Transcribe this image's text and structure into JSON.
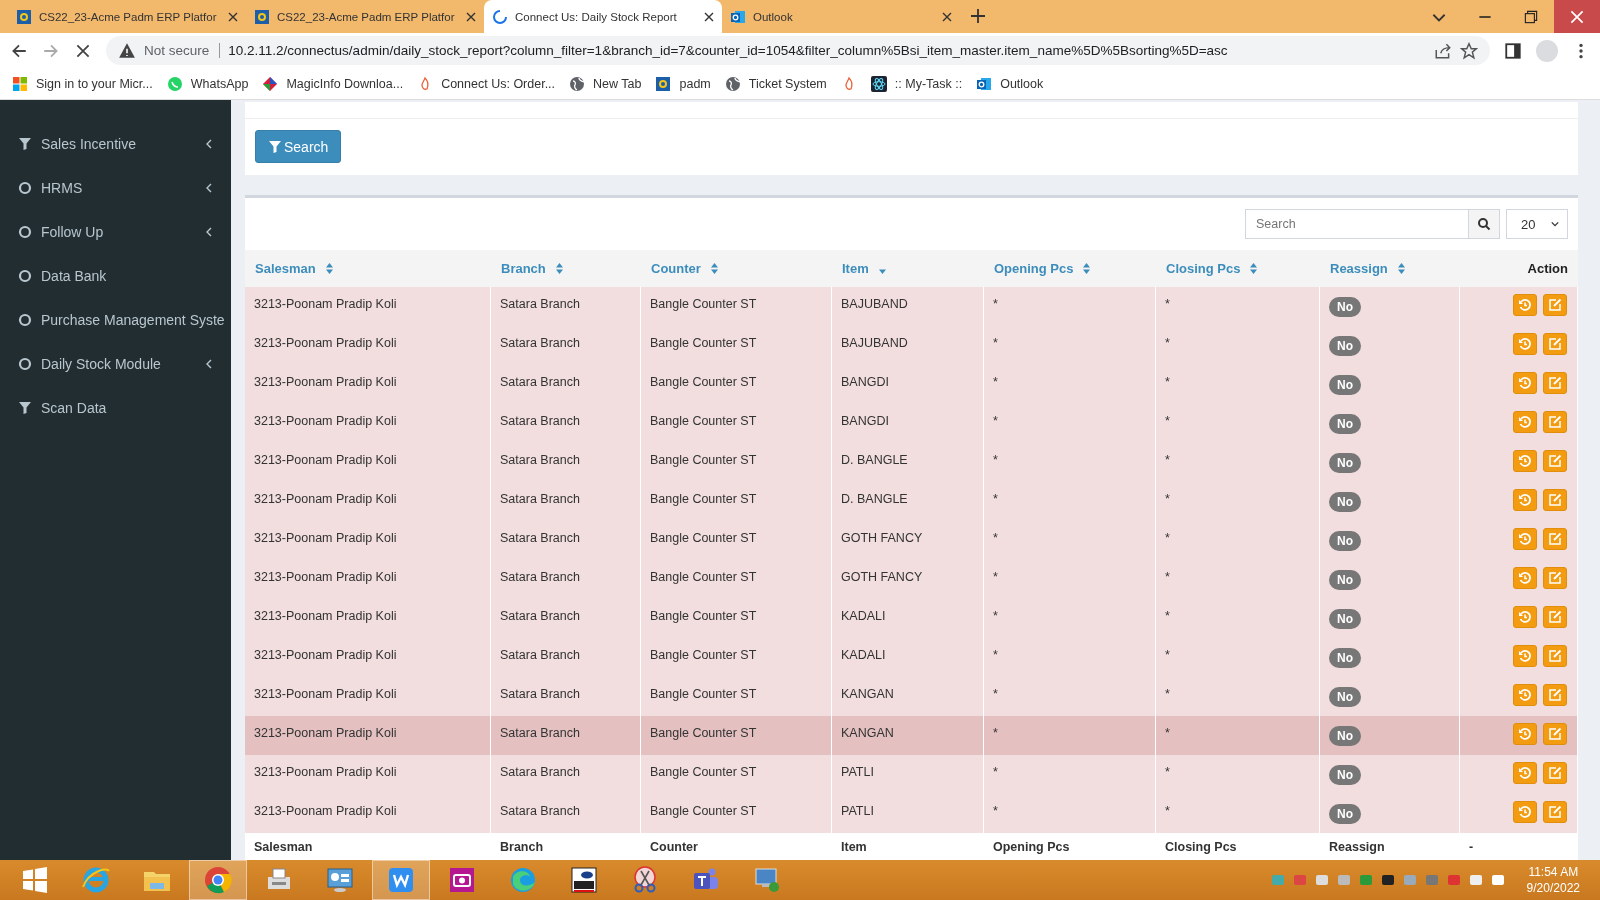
{
  "browser": {
    "tabs": [
      {
        "title": "CS22_23-Acme Padm ERP Platfor",
        "kind": "erp",
        "selected": false
      },
      {
        "title": "CS22_23-Acme Padm ERP Platfor",
        "kind": "erp",
        "selected": false
      },
      {
        "title": "Connect Us: Daily Stock Report",
        "kind": "loading",
        "selected": true
      },
      {
        "title": "Outlook",
        "kind": "outlook",
        "selected": false
      }
    ],
    "security": "Not secure",
    "url": "10.2.11.2/connectus/admin/daily_stock_report?column_filter=1&branch_id=7&counter_id=1054&filter_column%5Bsi_item_master.item_name%5D%5Bsorting%5D=asc",
    "bookmarks": [
      {
        "label": "Sign in to your Micr...",
        "kind": "windows"
      },
      {
        "label": "WhatsApp",
        "kind": "whatsapp"
      },
      {
        "label": "MagicInfo Downloa...",
        "kind": "diamond"
      },
      {
        "label": "Connect Us: Order...",
        "kind": "connect"
      },
      {
        "label": "New Tab",
        "kind": "globe"
      },
      {
        "label": "padm",
        "kind": "erp"
      },
      {
        "label": "Ticket System",
        "kind": "globe"
      },
      {
        "kind": "connect"
      },
      {
        "label": ":: My-Task ::",
        "kind": "atom"
      },
      {
        "label": "Outlook",
        "kind": "outlook"
      }
    ]
  },
  "sidebar": {
    "items": [
      {
        "label": "Sales Incentive",
        "kind": "filter",
        "expandable": true
      },
      {
        "label": "HRMS",
        "kind": "circle",
        "expandable": true
      },
      {
        "label": "Follow Up",
        "kind": "circle",
        "expandable": true
      },
      {
        "label": "Data Bank",
        "kind": "circle",
        "expandable": false
      },
      {
        "label": "Purchase Management Syste",
        "kind": "circle",
        "expandable": false
      },
      {
        "label": "Daily Stock Module",
        "kind": "circle",
        "expandable": true
      },
      {
        "label": "Scan Data",
        "kind": "filter",
        "expandable": false
      }
    ]
  },
  "filter": {
    "button": "Search"
  },
  "table": {
    "search": {
      "placeholder": "Search"
    },
    "page_size": "20",
    "columns": [
      {
        "label": "Salesman",
        "sortable": true,
        "sorted": false
      },
      {
        "label": "Branch",
        "sortable": true,
        "sorted": false
      },
      {
        "label": "Counter",
        "sortable": true,
        "sorted": false
      },
      {
        "label": "Item",
        "sortable": true,
        "sorted": true
      },
      {
        "label": "Opening Pcs",
        "sortable": true,
        "sorted": false
      },
      {
        "label": "Closing Pcs",
        "sortable": true,
        "sorted": false
      },
      {
        "label": "Reassign",
        "sortable": true,
        "sorted": false
      },
      {
        "label": "Action",
        "sortable": false
      }
    ],
    "rows": [
      {
        "cells": [
          "3213-Poonam Pradip Koli",
          "Satara Branch",
          "Bangle Counter ST",
          "BAJUBAND",
          "*",
          "*"
        ],
        "reassign": "No",
        "highlighted": false
      },
      {
        "cells": [
          "3213-Poonam Pradip Koli",
          "Satara Branch",
          "Bangle Counter ST",
          "BAJUBAND",
          "*",
          "*"
        ],
        "reassign": "No",
        "highlighted": false
      },
      {
        "cells": [
          "3213-Poonam Pradip Koli",
          "Satara Branch",
          "Bangle Counter ST",
          "BANGDI",
          "*",
          "*"
        ],
        "reassign": "No",
        "highlighted": false
      },
      {
        "cells": [
          "3213-Poonam Pradip Koli",
          "Satara Branch",
          "Bangle Counter ST",
          "BANGDI",
          "*",
          "*"
        ],
        "reassign": "No",
        "highlighted": false
      },
      {
        "cells": [
          "3213-Poonam Pradip Koli",
          "Satara Branch",
          "Bangle Counter ST",
          "D. BANGLE",
          "*",
          "*"
        ],
        "reassign": "No",
        "highlighted": false
      },
      {
        "cells": [
          "3213-Poonam Pradip Koli",
          "Satara Branch",
          "Bangle Counter ST",
          "D. BANGLE",
          "*",
          "*"
        ],
        "reassign": "No",
        "highlighted": false
      },
      {
        "cells": [
          "3213-Poonam Pradip Koli",
          "Satara Branch",
          "Bangle Counter ST",
          "GOTH FANCY",
          "*",
          "*"
        ],
        "reassign": "No",
        "highlighted": false
      },
      {
        "cells": [
          "3213-Poonam Pradip Koli",
          "Satara Branch",
          "Bangle Counter ST",
          "GOTH FANCY",
          "*",
          "*"
        ],
        "reassign": "No",
        "highlighted": false
      },
      {
        "cells": [
          "3213-Poonam Pradip Koli",
          "Satara Branch",
          "Bangle Counter ST",
          "KADALI",
          "*",
          "*"
        ],
        "reassign": "No",
        "highlighted": false
      },
      {
        "cells": [
          "3213-Poonam Pradip Koli",
          "Satara Branch",
          "Bangle Counter ST",
          "KADALI",
          "*",
          "*"
        ],
        "reassign": "No",
        "highlighted": false
      },
      {
        "cells": [
          "3213-Poonam Pradip Koli",
          "Satara Branch",
          "Bangle Counter ST",
          "KANGAN",
          "*",
          "*"
        ],
        "reassign": "No",
        "highlighted": false
      },
      {
        "cells": [
          "3213-Poonam Pradip Koli",
          "Satara Branch",
          "Bangle Counter ST",
          "KANGAN",
          "*",
          "*"
        ],
        "reassign": "No",
        "highlighted": true
      },
      {
        "cells": [
          "3213-Poonam Pradip Koli",
          "Satara Branch",
          "Bangle Counter ST",
          "PATLI",
          "*",
          "*"
        ],
        "reassign": "No",
        "highlighted": false
      },
      {
        "cells": [
          "3213-Poonam Pradip Koli",
          "Satara Branch",
          "Bangle Counter ST",
          "PATLI",
          "*",
          "*"
        ],
        "reassign": "No",
        "highlighted": false
      }
    ],
    "footer": [
      "Salesman",
      "Branch",
      "Counter",
      "Item",
      "Opening Pcs",
      "Closing Pcs",
      "Reassign",
      "-"
    ]
  },
  "taskbar": {
    "apps": [
      {
        "kind": "windows",
        "active": false
      },
      {
        "kind": "ie",
        "active": false
      },
      {
        "kind": "folder",
        "active": false
      },
      {
        "kind": "chrome",
        "active": true
      },
      {
        "kind": "fax",
        "active": false
      },
      {
        "kind": "panel",
        "active": false
      },
      {
        "kind": "wps",
        "active": true
      },
      {
        "kind": "camera",
        "active": false
      },
      {
        "kind": "edge",
        "active": false
      },
      {
        "kind": "vnc",
        "active": false
      },
      {
        "kind": "scissors",
        "active": false
      },
      {
        "kind": "teams",
        "active": false
      },
      {
        "kind": "remote",
        "active": false
      }
    ],
    "time": "11:54 AM",
    "date": "9/20/2022"
  }
}
